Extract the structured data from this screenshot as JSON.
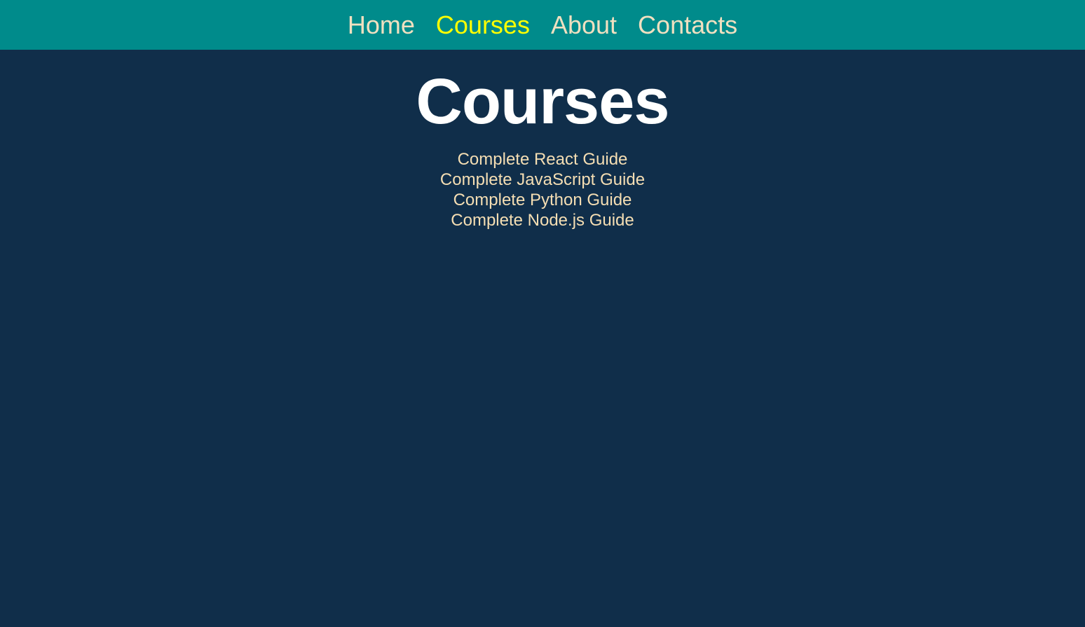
{
  "nav": {
    "items": [
      {
        "label": "Home",
        "active": false
      },
      {
        "label": "Courses",
        "active": true
      },
      {
        "label": "About",
        "active": false
      },
      {
        "label": "Contacts",
        "active": false
      }
    ]
  },
  "main": {
    "title": "Courses",
    "courses": [
      "Complete React Guide",
      "Complete JavaScript Guide",
      "Complete Python Guide",
      "Complete Node.js Guide"
    ]
  },
  "colors": {
    "navbar_bg": "#008b8b",
    "page_bg": "#102e4a",
    "nav_text": "#f0e0c0",
    "nav_active": "#ffff00",
    "title_text": "#ffffff",
    "course_text": "#f5deb3"
  }
}
